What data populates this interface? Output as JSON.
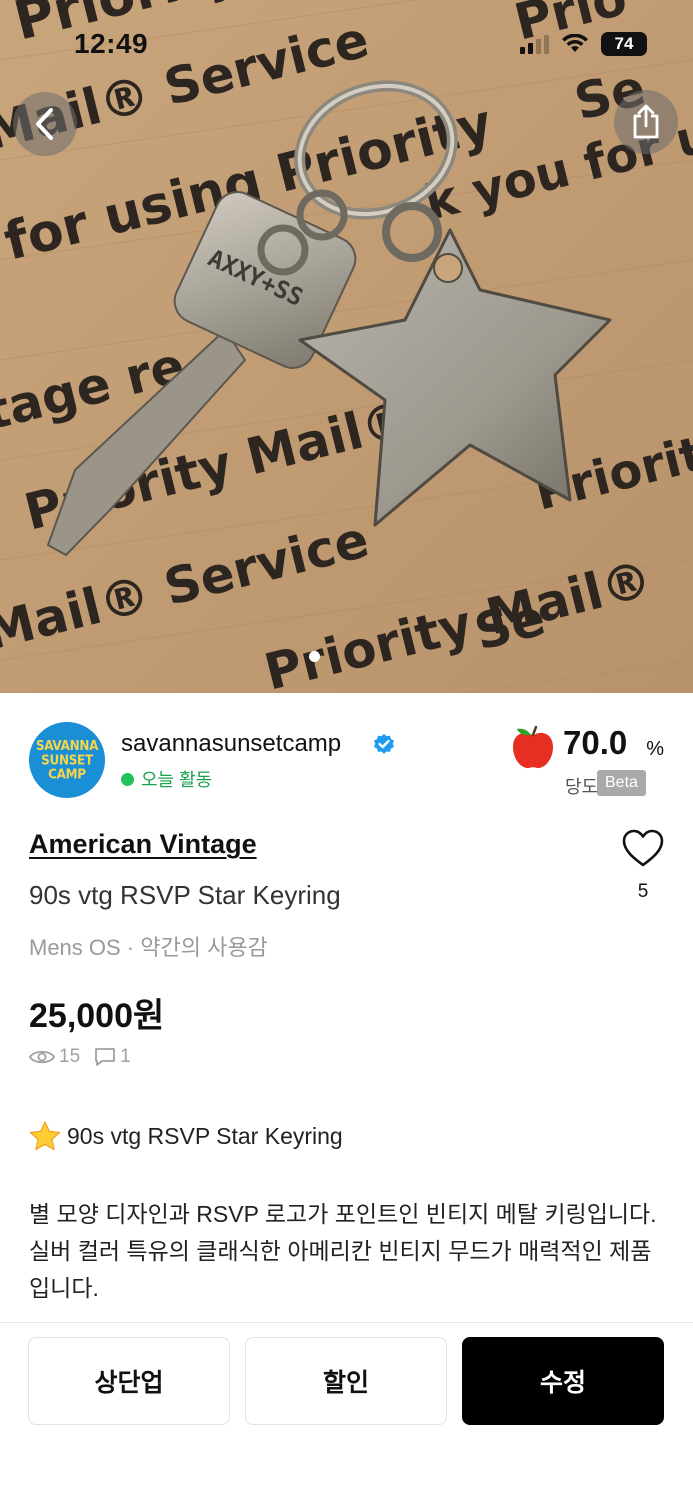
{
  "status_bar": {
    "time": "12:49",
    "battery": "74"
  },
  "photo": {
    "alt_icons": [
      "back-icon",
      "share-icon"
    ],
    "printed_text": [
      "Priority",
      "Mail® Service",
      "for using Priority",
      "k you for usir",
      "tage re",
      "Priority Mail®",
      "Priorit",
      "Mail® Service",
      "Priority Mail®",
      "ing"
    ]
  },
  "seller": {
    "avatar_lines": [
      "SAVANNA",
      "SUNSET",
      "CAMP"
    ],
    "name": "savannasunsetcamp",
    "activity": "오늘 활동",
    "rating_value": "70.0",
    "rating_unit": "%",
    "rating_label": "당도",
    "beta": "Beta"
  },
  "product": {
    "brand": "American Vintage",
    "title": "90s vtg RSVP Star Keyring",
    "meta": "Mens OS · 약간의 사용감",
    "likes": "5",
    "price": "25,000원",
    "views": "15",
    "comments": "1",
    "desc_title": "90s vtg RSVP Star Keyring",
    "description": "별 모양 디자인과 RSVP 로고가 포인트인 빈티지 메탈 키링입니다. 실버 컬러 특유의 클래식한 아메리칸 빈티지 무드가 매력적인 제품입니다."
  },
  "actions": {
    "bump": "상단업",
    "discount": "할인",
    "edit": "수정"
  },
  "colors": {
    "accent_green": "#21c15c",
    "verified_blue": "#1d9bf0",
    "primary_button": "#000000",
    "avatar_blue": "#1a8fd6"
  }
}
